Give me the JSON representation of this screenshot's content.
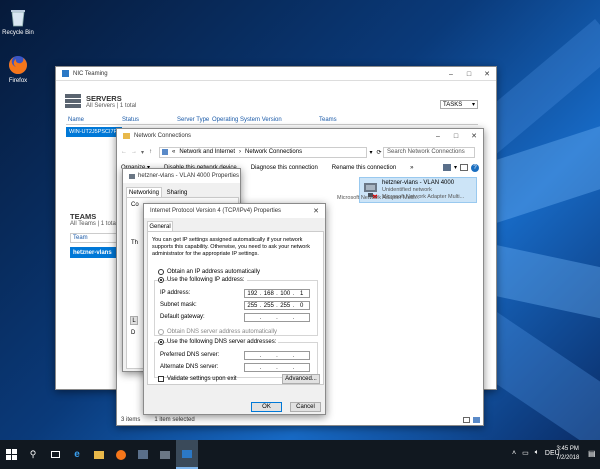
{
  "desktop": {
    "recycle_bin": "Recycle Bin",
    "firefox": "Firefox"
  },
  "nic_teaming": {
    "title": "NIC Teaming",
    "servers_heading": "SERVERS",
    "servers_sub": "All Servers | 1 total",
    "tasks_label": "TASKS",
    "columns": [
      "Name",
      "Status",
      "Server Type",
      "Operating System Version",
      "Teams"
    ],
    "server_row": "WIN-UT2J5PSCI7R",
    "teams_heading": "TEAMS",
    "teams_sub": "All Teams | 1 total",
    "teams_col": "Team",
    "team_row": "hetzner-vlans"
  },
  "network_connections": {
    "title": "Network Connections",
    "breadcrumb_prefix": "«",
    "breadcrumb_1": "Network and Internet",
    "breadcrumb_2": "Network Connections",
    "search_placeholder": "Search Network Connections",
    "toolbar": {
      "organize": "Organize ▾",
      "disable": "Disable this network device",
      "diagnose": "Diagnose this connection",
      "rename": "Rename this connection",
      "more": "»"
    },
    "adapter": {
      "name": "hetzner-vlans - VLAN 4000",
      "status": "Unidentified network",
      "device": "Microsoft Network Adapter Multi..."
    },
    "other_adapter": "Microsoft Network Adapter Multi...",
    "status_items": "3 items",
    "status_selected": "1 item selected"
  },
  "vlan_props": {
    "title": "hetzner-vlans - VLAN 4000 Properties",
    "tab_networking": "Networking",
    "tab_sharing": "Sharing",
    "partial_c": "Co",
    "partial_t": "Th",
    "partial_l": "L",
    "partial_d": "D"
  },
  "ipv4": {
    "title": "Internet Protocol Version 4 (TCP/IPv4) Properties",
    "tab_general": "General",
    "description": "You can get IP settings assigned automatically if your network supports this capability. Otherwise, you need to ask your network administrator for the appropriate IP settings.",
    "obtain_auto": "Obtain an IP address automatically",
    "use_following": "Use the following IP address:",
    "ip_label": "IP address:",
    "ip_octets": [
      "192",
      "168",
      "100",
      "1"
    ],
    "mask_label": "Subnet mask:",
    "mask_octets": [
      "255",
      "255",
      "255",
      "0"
    ],
    "gateway_label": "Default gateway:",
    "dns_auto": "Obtain DNS server address automatically",
    "dns_use_following": "Use the following DNS server addresses:",
    "preferred_dns": "Preferred DNS server:",
    "alternate_dns": "Alternate DNS server:",
    "validate": "Validate settings upon exit",
    "advanced": "Advanced...",
    "ok": "OK",
    "cancel": "Cancel"
  },
  "taskbar": {
    "time": "3:45 PM",
    "date": "7/2/2018",
    "lang": "DEU"
  }
}
